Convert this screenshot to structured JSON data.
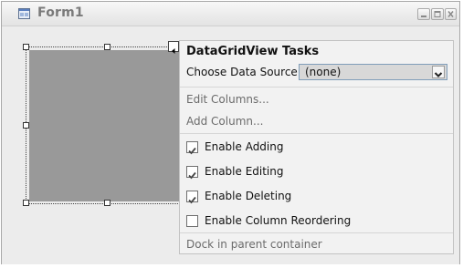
{
  "window": {
    "title": "Form1",
    "icons": {
      "form": "form-icon",
      "minimize": "minimize-icon",
      "maximize": "maximize-icon",
      "close": "close-icon"
    }
  },
  "designer": {
    "grid_color": "#999999",
    "smart_tag_icon": "smart-tag-arrow-icon"
  },
  "tasks": {
    "header": "DataGridView Tasks",
    "choose_data_source_label": "Choose Data Source",
    "data_source_value": "(none)",
    "data_source_arrow_icon": "chevron-down-icon",
    "edit_columns": "Edit Columns...",
    "add_column": "Add Column...",
    "checkboxes": [
      {
        "label": "Enable Adding",
        "checked": true
      },
      {
        "label": "Enable Editing",
        "checked": true
      },
      {
        "label": "Enable Deleting",
        "checked": true
      },
      {
        "label": "Enable Column Reordering",
        "checked": false
      }
    ],
    "dock": "Dock in parent container"
  }
}
